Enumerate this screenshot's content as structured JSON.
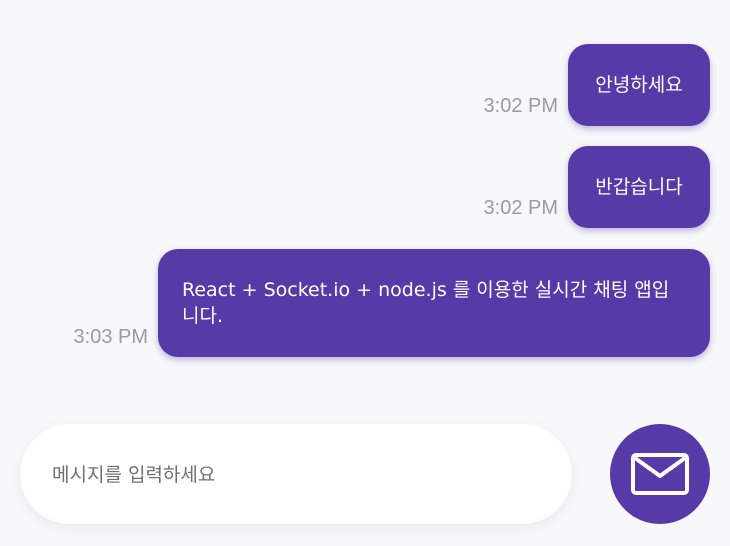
{
  "messages": [
    {
      "text": "안녕하세요",
      "time": "3:02 PM"
    },
    {
      "text": "반갑습니다",
      "time": "3:02 PM"
    },
    {
      "text": "React + Socket.io + node.js 를 이용한 실시간 채팅 앱입니다.",
      "time": "3:03 PM"
    }
  ],
  "composer": {
    "placeholder": "메시지를 입력하세요",
    "value": ""
  },
  "send_button": {
    "icon": "mail-icon"
  },
  "colors": {
    "accent": "#563aa8",
    "background": "#f8f8fa",
    "timestamp": "#9a9aa0"
  }
}
